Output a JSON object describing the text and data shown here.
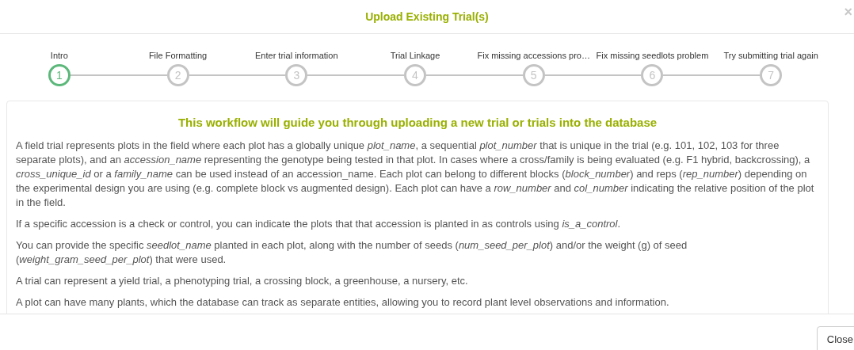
{
  "dialog": {
    "title": "Upload Existing Trial(s)",
    "close_icon": "×"
  },
  "steps": [
    {
      "label": "Intro",
      "number": "1",
      "selected": true
    },
    {
      "label": "File Formatting",
      "number": "2",
      "selected": false
    },
    {
      "label": "Enter trial information",
      "number": "3",
      "selected": false
    },
    {
      "label": "Trial Linkage",
      "number": "4",
      "selected": false
    },
    {
      "label": "Fix missing accessions pro…",
      "number": "5",
      "selected": false
    },
    {
      "label": "Fix missing seedlots problem",
      "number": "6",
      "selected": false
    },
    {
      "label": "Try submitting trial again",
      "number": "7",
      "selected": false
    }
  ],
  "content": {
    "heading": "This workflow will guide you through uploading a new trial or trials into the database",
    "paragraphs": [
      "A field trial represents plots in the field where each plot has a globally unique *plot_name*, a sequential *plot_number* that is unique in the trial (e.g. 101, 102, 103 for three separate plots), and an *accession_name* representing the genotype being tested in that plot. In cases where a cross/family is being evaluated (e.g. F1 hybrid, backcrossing), a *cross_unique_id* or a *family_name* can be used instead of an accession_name. Each plot can belong to different blocks (*block_number*) and reps (*rep_number*) depending on the experimental design you are using (e.g. complete block vs augmented design). Each plot can have a *row_number* and *col_number* indicating the relative position of the plot in the field.",
      "If a specific accession is a check or control, you can indicate the plots that that accession is planted in as controls using *is_a_control*.",
      "You can provide the specific *seedlot_name* planted in each plot, along with the number of seeds (*num_seed_per_plot*) and/or the weight (g) of seed (*weight_gram_seed_per_plot*) that were used.",
      "A trial can represent a yield trial, a phenotyping trial, a crossing block, a greenhouse, a nursery, etc.",
      "A plot can have many plants, which the database can track as separate entities, allowing you to record plant level observations and information."
    ]
  },
  "footer": {
    "close_button": "Close"
  }
}
